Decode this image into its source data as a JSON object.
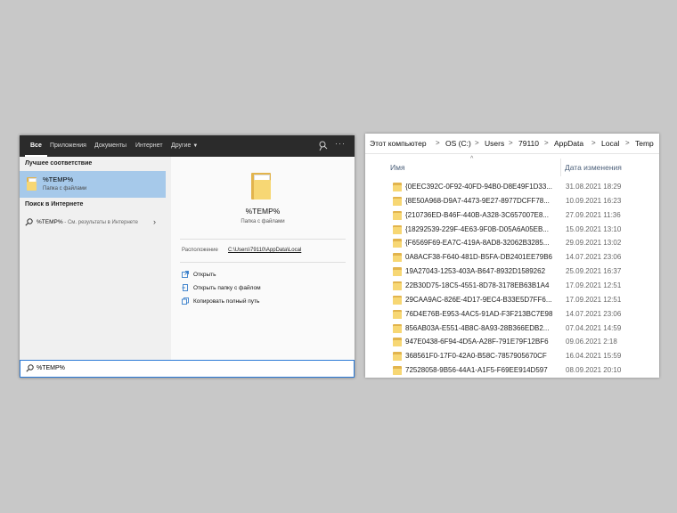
{
  "search": {
    "tabs": [
      "Все",
      "Приложения",
      "Документы",
      "Интернет",
      "Другие"
    ],
    "icons": {
      "feedback": "feedback-icon",
      "more": "more-icon"
    },
    "more_label": "···",
    "best_match_header": "Лучшее соответствие",
    "best_match": {
      "title": "%TEMP%",
      "subtitle": "Папка с файлами"
    },
    "web_header": "Поиск в Интернете",
    "web_item": {
      "query": "%TEMP%",
      "suffix": " - См. результаты в Интернете"
    },
    "preview": {
      "title": "%TEMP%",
      "subtitle": "Папка с файлами",
      "location_label": "Расположение",
      "location_value": "C:\\Users\\79110\\AppData\\Local",
      "actions": [
        "Открыть",
        "Открыть папку с файлом",
        "Копировать полный путь"
      ]
    },
    "input_value": "%TEMP%",
    "accent": "#a6c9ea"
  },
  "explorer": {
    "breadcrumb": [
      "Этот компьютер",
      "OS (C:)",
      "Users",
      "79110",
      "AppData",
      "Local",
      "Temp"
    ],
    "columns": {
      "name": "Имя",
      "date": "Дата изменения"
    },
    "rows": [
      {
        "name": "{0EEC392C-0F92-40FD-94B0-D8E49F1D33...",
        "date": "31.08.2021 18:29"
      },
      {
        "name": "{8E50A968-D9A7-4473-9E27-8977DCFF78...",
        "date": "10.09.2021 16:23"
      },
      {
        "name": "{210736ED-B46F-440B-A328-3C657007E8...",
        "date": "27.09.2021 11:36"
      },
      {
        "name": "{18292539-229F-4E63-9F0B-D05A6A05EB...",
        "date": "15.09.2021 13:10"
      },
      {
        "name": "{F6569F69-EA7C-419A-8AD8-32062B3285...",
        "date": "29.09.2021 13:02"
      },
      {
        "name": "0A8ACF38-F640-481D-B5FA-DB2401EE79B6",
        "date": "14.07.2021 23:06"
      },
      {
        "name": "19A27043-1253-403A-B647-8932D1589262",
        "date": "25.09.2021 16:37"
      },
      {
        "name": "22B30D75-18C5-4551-8D78-3178EB63B1A4",
        "date": "17.09.2021 12:51"
      },
      {
        "name": "29CAA9AC-826E-4D17-9EC4-B33E5D7FF6...",
        "date": "17.09.2021 12:51"
      },
      {
        "name": "76D4E76B-E953-4AC5-91AD-F3F213BC7E98",
        "date": "14.07.2021 23:06"
      },
      {
        "name": "856AB03A-E551-4B8C-8A93-28B366EDB2...",
        "date": "07.04.2021 14:59"
      },
      {
        "name": "947E0438-6F94-4D5A-A28F-791E79F12BF6",
        "date": "09.06.2021 2:18"
      },
      {
        "name": "368561F0-17F0-42A0-B58C-7857905670CF",
        "date": "16.04.2021 15:59"
      },
      {
        "name": "72528058-9B56-44A1-A1F5-F69EE914D597",
        "date": "08.09.2021 20:10"
      }
    ],
    "folder_color": "#f7d774"
  }
}
